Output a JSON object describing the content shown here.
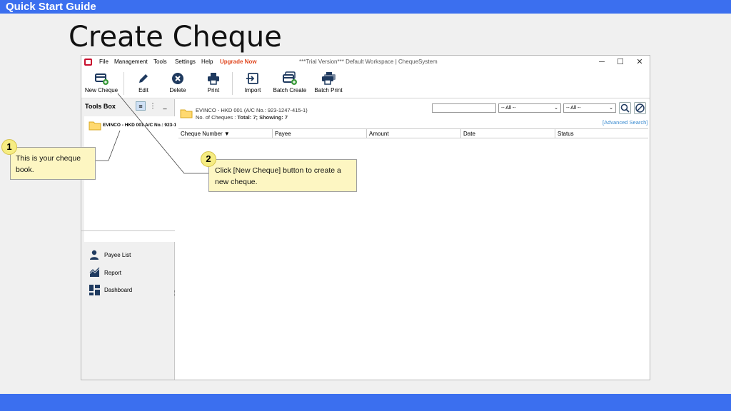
{
  "slide": {
    "header": "Quick Start Guide",
    "title": "Create Cheque"
  },
  "window": {
    "menu": [
      "File",
      "Management",
      "Tools",
      "Settings",
      "Help"
    ],
    "upgrade": "Upgrade Now",
    "title": "***Trial Version*** Default Workspace | ChequeSystem",
    "controls": {
      "minimize": "─",
      "maximize": "☐",
      "close": "✕"
    }
  },
  "toolbar": {
    "new_cheque": "New Cheque",
    "edit": "Edit",
    "delete": "Delete",
    "print": "Print",
    "import": "Import",
    "batch_create": "Batch Create",
    "batch_print": "Batch Print"
  },
  "sidebar": {
    "title": "Tools Box",
    "view_buttons": [
      "≡",
      "⋮",
      "_"
    ],
    "cheque_book": "EVINCO - HKD 001 A/C No.: 923-1",
    "items": [
      "Payee List",
      "Report",
      "Dashboard"
    ]
  },
  "main": {
    "account_title": "EVINCO - HKD 001 (A/C No.: 923-1247-415-1)",
    "cheque_count_label": "No. of Cheques : ",
    "cheque_count_value": "Total: 7; Showing: 7",
    "search_value": "",
    "filter1": "-- All --",
    "filter2": "-- All --",
    "advanced_search": "[Advanced Search]",
    "columns": [
      "Cheque Number ▼",
      "Payee",
      "Amount",
      "Date",
      "Status"
    ]
  },
  "callouts": [
    {
      "number": "1",
      "text": "This is your cheque book."
    },
    {
      "number": "2",
      "text": "Click [New Cheque] button to create a new cheque."
    }
  ],
  "colors": {
    "accent_bar": "#3b6fef",
    "callout_bg": "#fdf6c2",
    "upgrade": "#e0461e",
    "link": "#3a8bd0"
  }
}
